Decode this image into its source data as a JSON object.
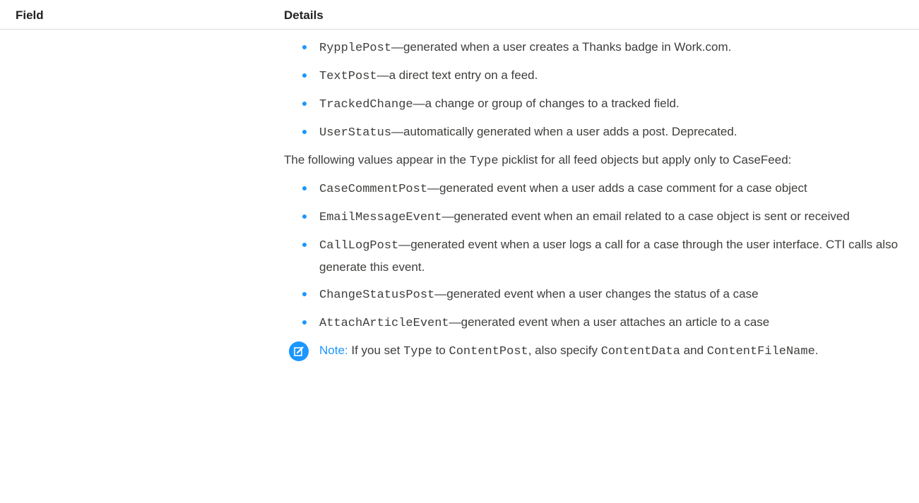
{
  "header": {
    "field": "Field",
    "details": "Details"
  },
  "bullets1": [
    {
      "code": "RypplePost",
      "text": "—generated when a user creates a Thanks badge in Work.com."
    },
    {
      "code": "TextPost",
      "text": "—a direct text entry on a feed."
    },
    {
      "code": "TrackedChange",
      "text": "—a change or group of changes to a tracked field."
    },
    {
      "code": "UserStatus",
      "text": "—automatically generated when a user adds a post. Deprecated."
    }
  ],
  "paragraph": {
    "before": "The following values appear in the ",
    "code": "Type",
    "after": " picklist for all feed objects but apply only to CaseFeed:"
  },
  "bullets2": [
    {
      "code": "CaseCommentPost",
      "text": "—generated event when a user adds a case comment for a case object"
    },
    {
      "code": "EmailMessageEvent",
      "text": "—generated event when an email related to a case object is sent or received"
    },
    {
      "code": "CallLogPost",
      "text": "—generated event when a user logs a call for a case through the user interface. CTI calls also generate this event."
    },
    {
      "code": "ChangeStatusPost",
      "text": "—generated event when a user changes the status of a case"
    },
    {
      "code": "AttachArticleEvent",
      "text": "—generated event when a user attaches an article to a case"
    }
  ],
  "note": {
    "icon": "note-edit-icon",
    "label": "Note:",
    "t1": " If you set ",
    "c1": "Type",
    "t2": " to ",
    "c2": "ContentPost",
    "t3": ", also specify ",
    "c3": "ContentData",
    "t4": " and ",
    "c4": "ContentFileName",
    "t5": "."
  },
  "colors": {
    "accent": "#1b96ff",
    "text": "#3e3e3c",
    "divider": "#dddbda"
  }
}
